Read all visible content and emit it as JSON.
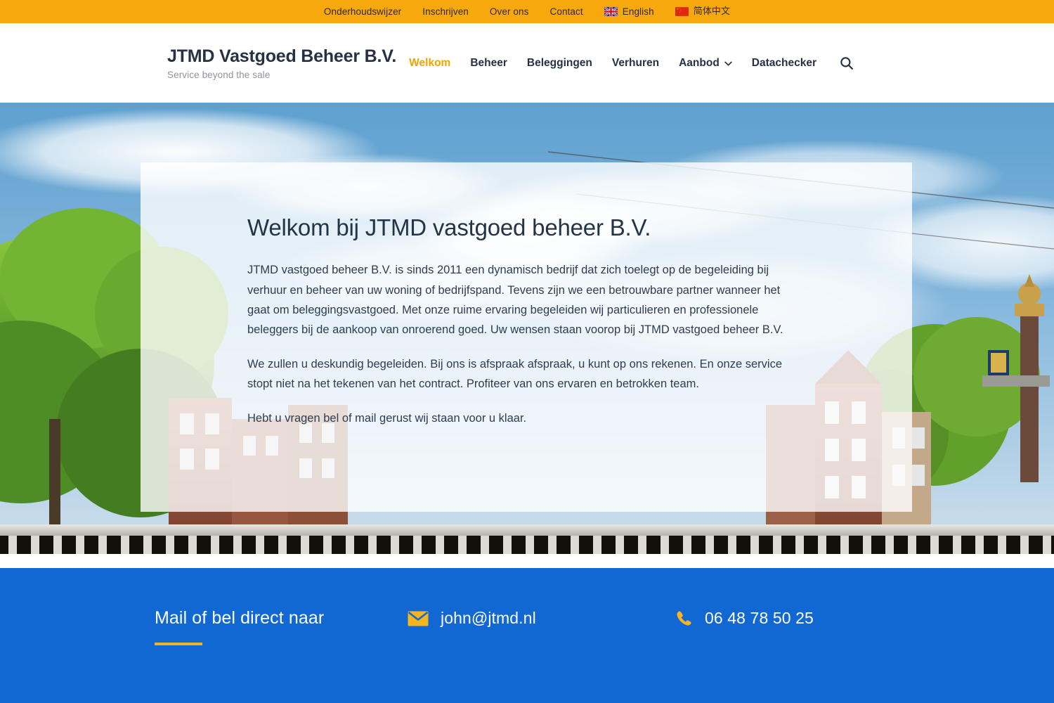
{
  "topbar": {
    "links": [
      {
        "label": "Onderhoudswijzer",
        "name": "topbar-link-onderhoudswijzer"
      },
      {
        "label": "Inschrijven",
        "name": "topbar-link-inschrijven"
      },
      {
        "label": "Over ons",
        "name": "topbar-link-over-ons"
      },
      {
        "label": "Contact",
        "name": "topbar-link-contact"
      }
    ],
    "languages": [
      {
        "label": "English",
        "flag": "uk-flag-icon"
      },
      {
        "label": "简体中文",
        "flag": "china-flag-icon"
      }
    ],
    "background_color": "#f7a80d",
    "text_color": "#2d2a23"
  },
  "header": {
    "brand_title": "JTMD Vastgoed Beheer B.V.",
    "brand_tagline": "Service beyond the sale",
    "nav": [
      {
        "label": "Welkom",
        "active": true,
        "has_dropdown": false
      },
      {
        "label": "Beheer",
        "active": false,
        "has_dropdown": false
      },
      {
        "label": "Beleggingen",
        "active": false,
        "has_dropdown": false
      },
      {
        "label": "Verhuren",
        "active": false,
        "has_dropdown": false
      },
      {
        "label": "Aanbod",
        "active": false,
        "has_dropdown": true
      },
      {
        "label": "Datachecker",
        "active": false,
        "has_dropdown": false
      }
    ],
    "search_icon": "search-icon",
    "accent_color": "#f0a500",
    "text_color": "#273142"
  },
  "hero": {
    "heading": "Welkom bij JTMD vastgoed beheer B.V.",
    "paragraphs": [
      "JTMD vastgoed beheer B.V. is sinds 2011 een dynamisch bedrijf dat zich toelegt op de begeleiding bij verhuur en beheer van uw woning of bedrijfspand. Tevens zijn we een betrouwbare partner wanneer het gaat om beleggingsvastgoed. Met onze ruime ervaring begeleiden wij particulieren en professionele beleggers bij de aankoop van onroerend goed. Uw wensen staan voorop bij JTMD vastgoed beheer B.V.",
      "We zullen u deskundig begeleiden. Bij ons is afspraak afspraak, u kunt op ons rekenen. En onze service stopt niet na het tekenen van het contract. Profiteer van ons ervaren en betrokken team.",
      "Hebt u vragen bel of mail gerust wij staan voor u klaar."
    ],
    "background_image": "amsterdam-canal-bridge-photo"
  },
  "footer": {
    "title": "Mail of bel direct naar",
    "email": "john@jtmd.nl",
    "email_icon": "envelope-icon",
    "phone": "06 48 78 50 25",
    "phone_icon": "phone-icon",
    "background_color": "#1268d3",
    "accent_color": "#f0b428"
  }
}
